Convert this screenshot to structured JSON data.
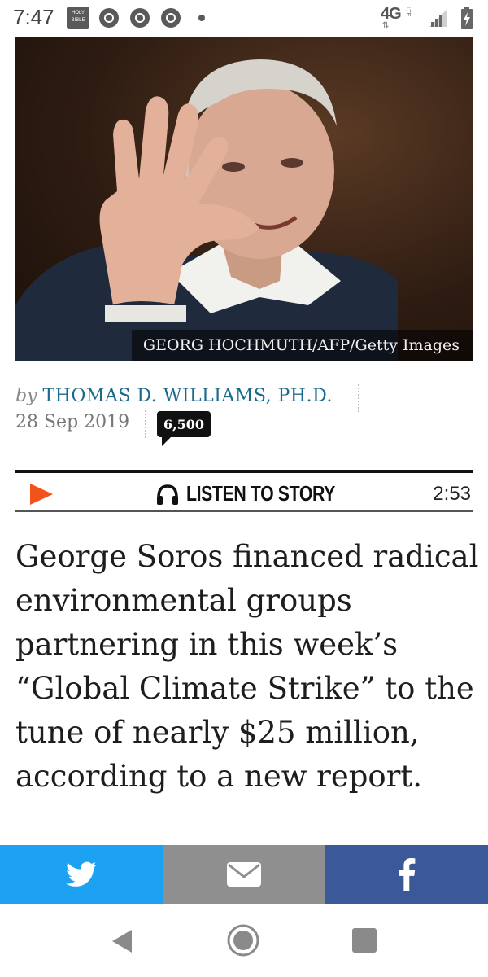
{
  "status_bar": {
    "time": "7:47",
    "bible_icon_text": "HOLY BIBLE",
    "network": "4G",
    "network_sub": "LTE"
  },
  "hero": {
    "photo_credit": "GEORG HOCHMUTH/AFP/Getty Images"
  },
  "byline": {
    "by": "by",
    "author": "THOMAS D. WILLIAMS, PH.D.",
    "date": "28 Sep 2019",
    "comment_count": "6,500"
  },
  "audio": {
    "label": "LISTEN TO STORY",
    "duration": "2:53"
  },
  "article": {
    "lead": "George Soros financed radical environmental groups partnering in this week’s “Global Climate Strike” to the tune of nearly $25 million, according to a new report."
  },
  "share": {
    "twitter_icon": "twitter-bird-icon",
    "email_icon": "envelope-icon",
    "facebook_icon": "facebook-f-icon"
  },
  "colors": {
    "author_link": "#1a6a8e",
    "play_accent": "#f2521c",
    "twitter": "#1da1f2",
    "email": "#8f8f8f",
    "facebook": "#3b5998"
  }
}
